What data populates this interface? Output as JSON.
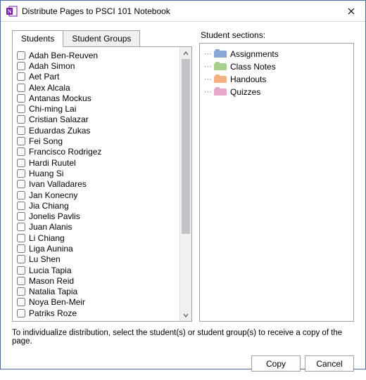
{
  "window": {
    "title": "Distribute Pages to PSCI 101 Notebook"
  },
  "tabs": {
    "students": "Students",
    "groups": "Student Groups"
  },
  "students": [
    "Adah Ben-Reuven",
    "Adah Simon",
    "Aet Part",
    "Alex Alcala",
    "Antanas Mockus",
    "Chi-ming Lai",
    "Cristian Salazar",
    "Eduardas Zukas",
    "Fei Song",
    "Francisco Rodrigez",
    "Hardi Ruutel",
    "Huang Si",
    "Ivan Valladares",
    "Jan Konecny",
    "Jia Chiang",
    "Jonelis Pavlis",
    "Juan Alanis",
    "Li Chiang",
    "Liga Aunina",
    "Lu Shen",
    "Lucia Tapia",
    "Mason Reid",
    "Natalia Tapia",
    "Noya Ben-Meir",
    "Patriks Roze"
  ],
  "sections_label": "Student sections:",
  "sections": [
    {
      "name": "Assignments",
      "color": "#8aa6d6"
    },
    {
      "name": "Class Notes",
      "color": "#a8d08d"
    },
    {
      "name": "Handouts",
      "color": "#f4b183"
    },
    {
      "name": "Quizzes",
      "color": "#e6a8c9"
    }
  ],
  "hint": "To individualize distribution, select the student(s) or student group(s) to receive a copy of the page.",
  "buttons": {
    "copy": "Copy",
    "cancel": "Cancel"
  }
}
